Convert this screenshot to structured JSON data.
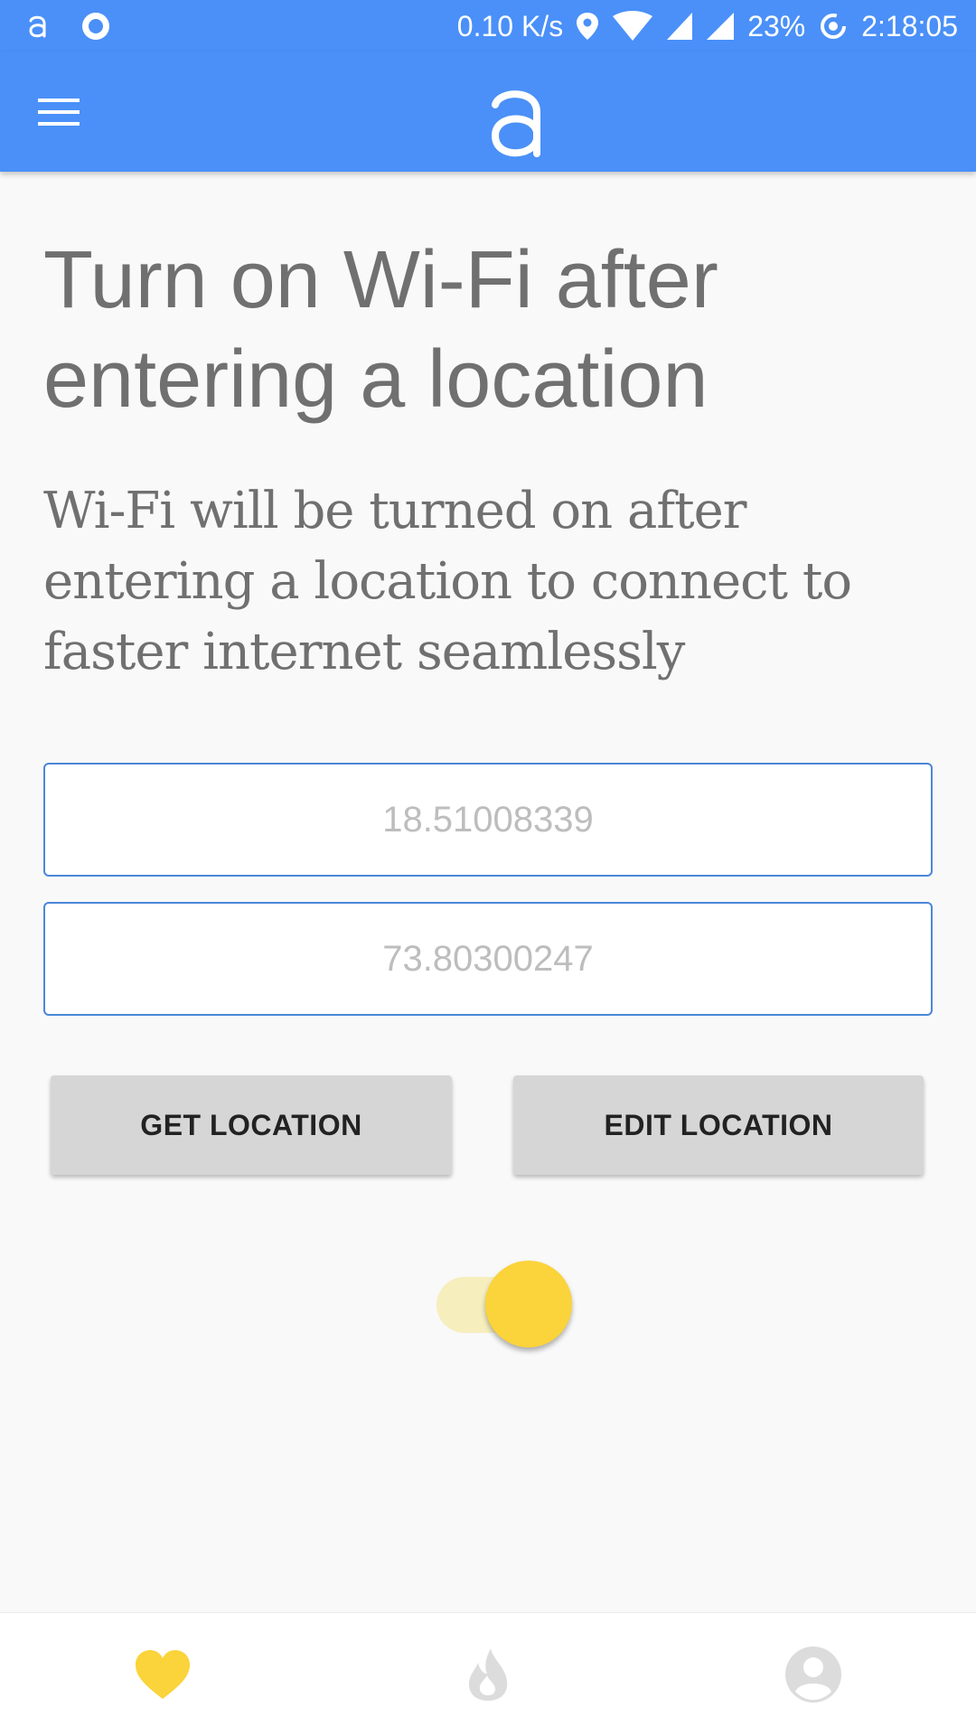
{
  "status_bar": {
    "network_speed": "0.10 K/s",
    "battery": "23%",
    "time": "2:18:05"
  },
  "app_bar": {
    "logo_icon": "alexa-logo-icon",
    "menu_icon": "hamburger-menu-icon"
  },
  "main": {
    "title": "Turn on Wi-Fi after entering a location",
    "description": "Wi-Fi will be turned on after entering a location to connect to faster internet seamlessly",
    "latitude_placeholder": "18.51008339",
    "longitude_placeholder": "73.80300247",
    "get_location_label": "GET LOCATION",
    "edit_location_label": "EDIT LOCATION",
    "toggle_on": true
  },
  "bottom_nav": {
    "items": [
      {
        "icon": "heart-icon",
        "active": true
      },
      {
        "icon": "flame-icon",
        "active": false
      },
      {
        "icon": "profile-icon",
        "active": false
      }
    ]
  },
  "colors": {
    "primary": "#4a90f8",
    "accent": "#fbd33a",
    "button": "#d6d6d6",
    "text_gray": "#707070"
  }
}
